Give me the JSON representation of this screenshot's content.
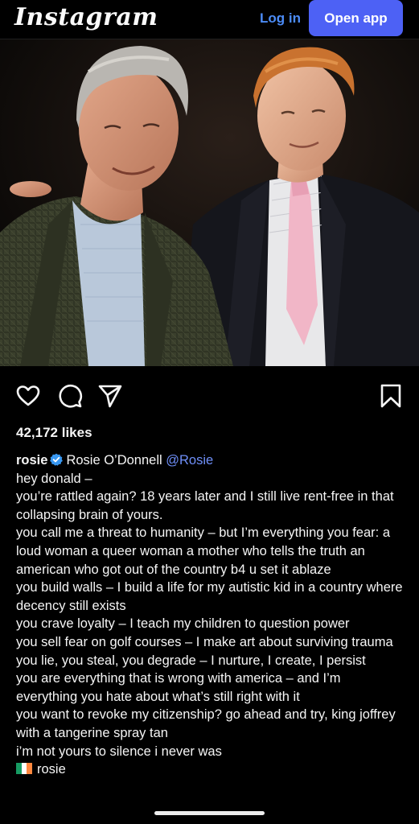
{
  "header": {
    "logo_text": "Instagram",
    "login_label": "Log in",
    "open_app_label": "Open app"
  },
  "post": {
    "likes_text": "42,172 likes",
    "username": "rosie",
    "display_name": "Rosie O’Donnell",
    "mention": "@Rosie",
    "caption_lines": [
      "hey donald –",
      "you’re rattled again?  18 years later and I still live rent-free in that collapsing brain of yours.",
      "you call me a threat to humanity – but I’m everything you fear: a loud woman a queer woman a mother who tells the truth an american who got out of the country b4 u set it ablaze",
      "you build walls – I build a life for my autistic kid in a country where decency still exists",
      "you crave loyalty – I teach my children to question power",
      "you sell fear on golf courses – I make art about surviving trauma",
      "you lie, you steal, you degrade – I nurture, I create, I persist",
      "you are everything that is wrong with america – and I’m everything you hate about what’s still right with it",
      "you want to revoke my citizenship? go ahead and try, king joffrey with a tangerine spray tan",
      "i’m not yours to silence i never was"
    ],
    "signoff": "rosie"
  },
  "icons": {
    "like": "heart-icon",
    "comment": "comment-bubble-icon",
    "share": "send-paper-plane-icon",
    "save": "bookmark-icon",
    "verified": "verified-badge-icon",
    "flag": "ireland-flag-icon"
  },
  "colors": {
    "accent": "#4d61f5",
    "link": "#4c8cf7",
    "verified": "#3897f0",
    "background": "#000000"
  }
}
